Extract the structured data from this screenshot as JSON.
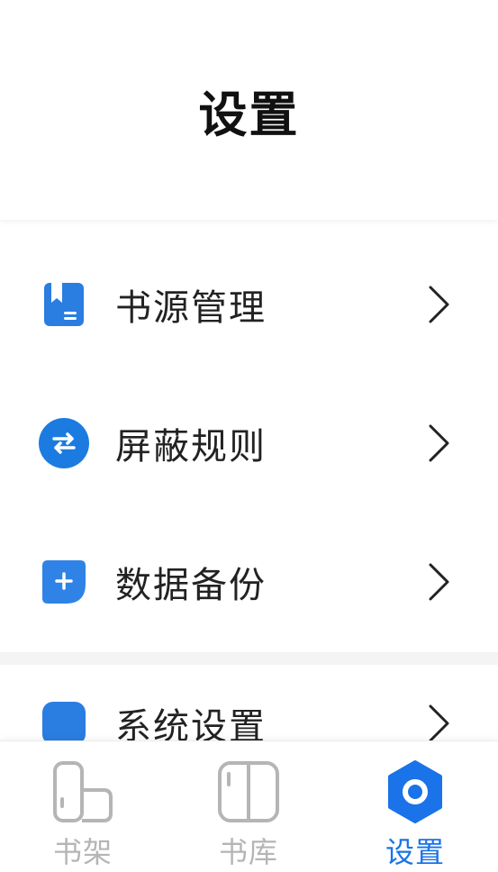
{
  "header": {
    "title": "设置"
  },
  "settings": {
    "items": [
      {
        "label": "书源管理",
        "icon": "book-source-icon"
      },
      {
        "label": "屏蔽规则",
        "icon": "swap-arrows-icon"
      },
      {
        "label": "数据备份",
        "icon": "plus-backup-icon"
      },
      {
        "label": "系统设置",
        "icon": "system-icon"
      }
    ]
  },
  "tabbar": {
    "tabs": [
      {
        "label": "书架",
        "icon": "bookshelf-icon",
        "active": false
      },
      {
        "label": "书库",
        "icon": "book-open-icon",
        "active": false
      },
      {
        "label": "设置",
        "icon": "settings-hex-icon",
        "active": true
      }
    ]
  },
  "colors": {
    "accent": "#1a73e8",
    "inactive": "#b5b5b5",
    "text": "#222222"
  }
}
